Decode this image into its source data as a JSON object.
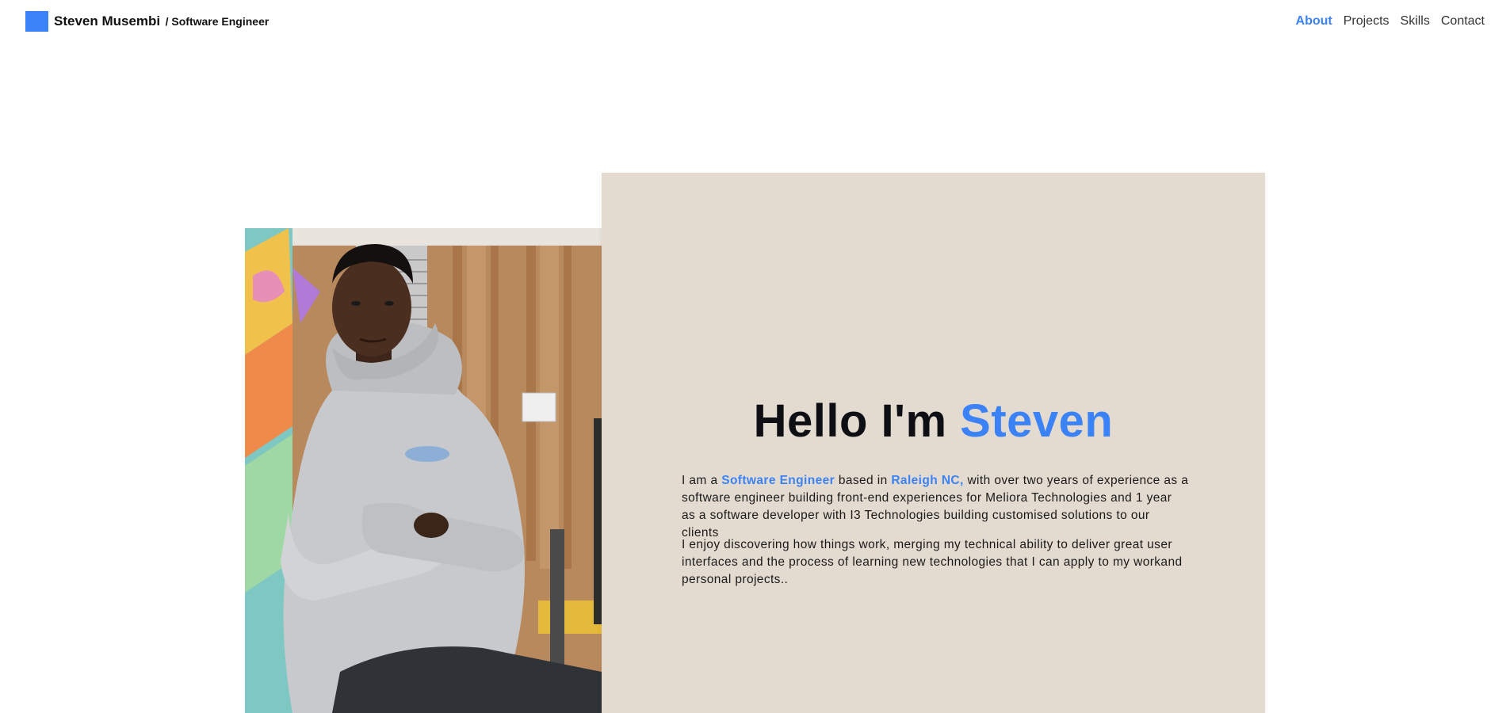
{
  "header": {
    "brand_name": "Steven Musembi",
    "brand_role": "/ Software Engineer",
    "logo_color": "#3b82f6"
  },
  "nav": {
    "items": [
      {
        "label": "About",
        "active": true
      },
      {
        "label": "Projects",
        "active": false
      },
      {
        "label": "Skills",
        "active": false
      },
      {
        "label": "Contact",
        "active": false
      }
    ]
  },
  "hero": {
    "greeting": "Hello I'm",
    "name": "Steven",
    "intro": {
      "prefix": "I am a",
      "role": "Software Engineer",
      "mid": "based in",
      "location": "Raleigh NC,",
      "rest": "with over two years of experience as a software engineer building front-end experiences for Meliora Technologies and 1 year as a software developer with I3 Technologies building customised solutions to our clients"
    },
    "paragraph2": "I enjoy discovering how things work, merging my technical ability to deliver great user interfaces and the process of learning new technologies that I can apply to my workand personal projects..",
    "photo": "portrait of man in grey hoodie with arms crossed, seated against wooden wall",
    "card_color": "#e4dbd0",
    "accent_color": "#3b82f6"
  }
}
